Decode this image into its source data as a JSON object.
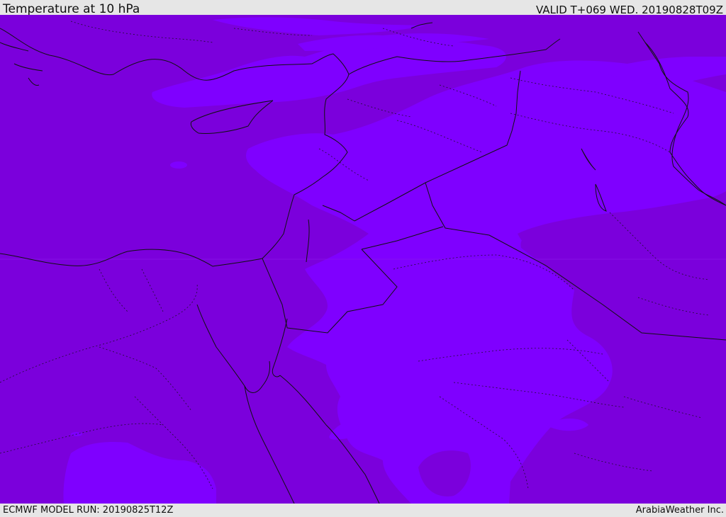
{
  "header": {
    "title": "Temperature at 10 hPa",
    "valid_time": "VALID T+069 WED. 20190828T09Z"
  },
  "footer": {
    "model_run": "ECMWF MODEL RUN: 20190825T12Z",
    "credit": "ArabiaWeather Inc."
  },
  "colors": {
    "field_dark": "#7b00dc",
    "field_light": "#7f00ff",
    "coastline": "#111111",
    "bar_background": "#e6e6e6"
  }
}
